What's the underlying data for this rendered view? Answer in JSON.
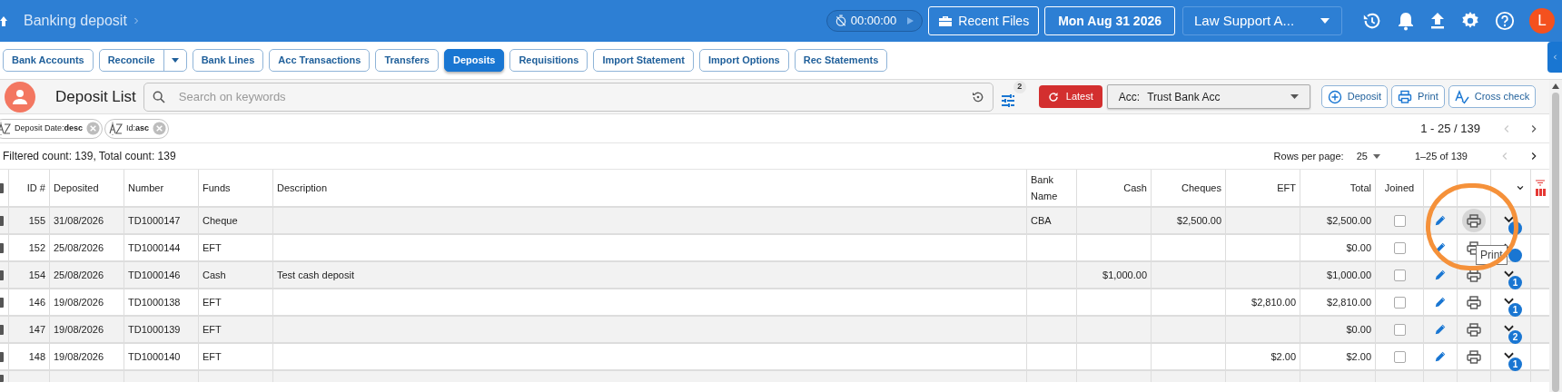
{
  "header": {
    "breadcrumb": "Banking deposit",
    "timer": "00:00:00",
    "recent_files": "Recent Files",
    "date": "Mon Aug 31 2026",
    "firm_select": "Law Support A...",
    "avatar_letter": "L"
  },
  "tabs": [
    {
      "label": "Bank Accounts",
      "selected": false,
      "kind": "plain"
    },
    {
      "label": "Reconcile",
      "selected": false,
      "kind": "split"
    },
    {
      "label": "Bank Lines",
      "selected": false,
      "kind": "plain"
    },
    {
      "label": "Acc Transactions",
      "selected": false,
      "kind": "plain"
    },
    {
      "label": "Transfers",
      "selected": false,
      "kind": "plain"
    },
    {
      "label": "Deposits",
      "selected": true,
      "kind": "plain"
    },
    {
      "label": "Requisitions",
      "selected": false,
      "kind": "plain"
    },
    {
      "label": "Import Statement",
      "selected": false,
      "kind": "plain"
    },
    {
      "label": "Import Options",
      "selected": false,
      "kind": "plain"
    },
    {
      "label": "Rec Statements",
      "selected": false,
      "kind": "plain"
    }
  ],
  "toolbar": {
    "title": "Deposit List",
    "search_placeholder": "Search on keywords",
    "filter_count": "2",
    "latest": "Latest",
    "account_label": "Acc:",
    "account_value": "Trust Bank Acc",
    "buttons": [
      {
        "label": "Deposit",
        "kind": "add"
      },
      {
        "label": "Print",
        "kind": "print"
      },
      {
        "label": "Cross check",
        "kind": "check"
      }
    ]
  },
  "sort_chips": [
    {
      "text": "Deposit Date:**desc**"
    },
    {
      "text": "Id:**asc**"
    }
  ],
  "top_pager": {
    "range": "1 - 25 / 139",
    "prev_enabled": false,
    "next_enabled": true
  },
  "counts": "Filtered count: 139, Total count: 139",
  "pager": {
    "rows_label": "Rows per page:",
    "rows_value": "25",
    "range": "1–25 of 139",
    "prev_enabled": false,
    "next_enabled": true
  },
  "table": {
    "select_all_checked": false,
    "columns": [
      {
        "label": "ID #",
        "kind": "number"
      },
      {
        "label": "Deposited",
        "kind": "text"
      },
      {
        "label": "Number",
        "kind": "text"
      },
      {
        "label": "Funds",
        "kind": "text"
      },
      {
        "label": "Description",
        "kind": "text"
      },
      {
        "label": "Bank Name",
        "kind": "text"
      },
      {
        "label": "Cash",
        "kind": "number"
      },
      {
        "label": "Cheques",
        "kind": "number"
      },
      {
        "label": "EFT",
        "kind": "number"
      },
      {
        "label": "Total",
        "kind": "number"
      },
      {
        "label": "Joined",
        "kind": "check"
      }
    ],
    "rows": [
      {
        "cells": [
          "155",
          "31/08/2026",
          "TD1000147",
          "Cheque",
          "",
          "CBA",
          "",
          "$2,500.00",
          "",
          "$2,500.00"
        ],
        "checked": false,
        "joined": false,
        "print_hovered": true,
        "badge": null
      },
      {
        "cells": [
          "152",
          "25/08/2026",
          "TD1000144",
          "EFT",
          "",
          "",
          "",
          "",
          "",
          "$0.00"
        ],
        "checked": false,
        "joined": false,
        "print_hovered": false,
        "badge": null
      },
      {
        "cells": [
          "154",
          "25/08/2026",
          "TD1000146",
          "Cash",
          "Test cash deposit",
          "",
          "$1,000.00",
          "",
          "",
          "$1,000.00"
        ],
        "checked": false,
        "joined": false,
        "print_hovered": false,
        "badge": "1"
      },
      {
        "cells": [
          "146",
          "19/08/2026",
          "TD1000138",
          "EFT",
          "",
          "",
          "",
          "",
          "$2,810.00",
          "$2,810.00"
        ],
        "checked": false,
        "joined": false,
        "print_hovered": false,
        "badge": "1"
      },
      {
        "cells": [
          "147",
          "19/08/2026",
          "TD1000139",
          "EFT",
          "",
          "",
          "",
          "",
          "",
          "$0.00"
        ],
        "checked": false,
        "joined": false,
        "print_hovered": false,
        "badge": "2"
      },
      {
        "cells": [
          "148",
          "19/08/2026",
          "TD1000140",
          "EFT",
          "",
          "",
          "",
          "",
          "$2.00",
          "$2.00"
        ],
        "checked": false,
        "joined": false,
        "print_hovered": false,
        "badge": "1"
      }
    ]
  },
  "partial_row": {
    "checked": false
  },
  "tooltip": "Print",
  "annotation": {
    "kind": "circle"
  }
}
